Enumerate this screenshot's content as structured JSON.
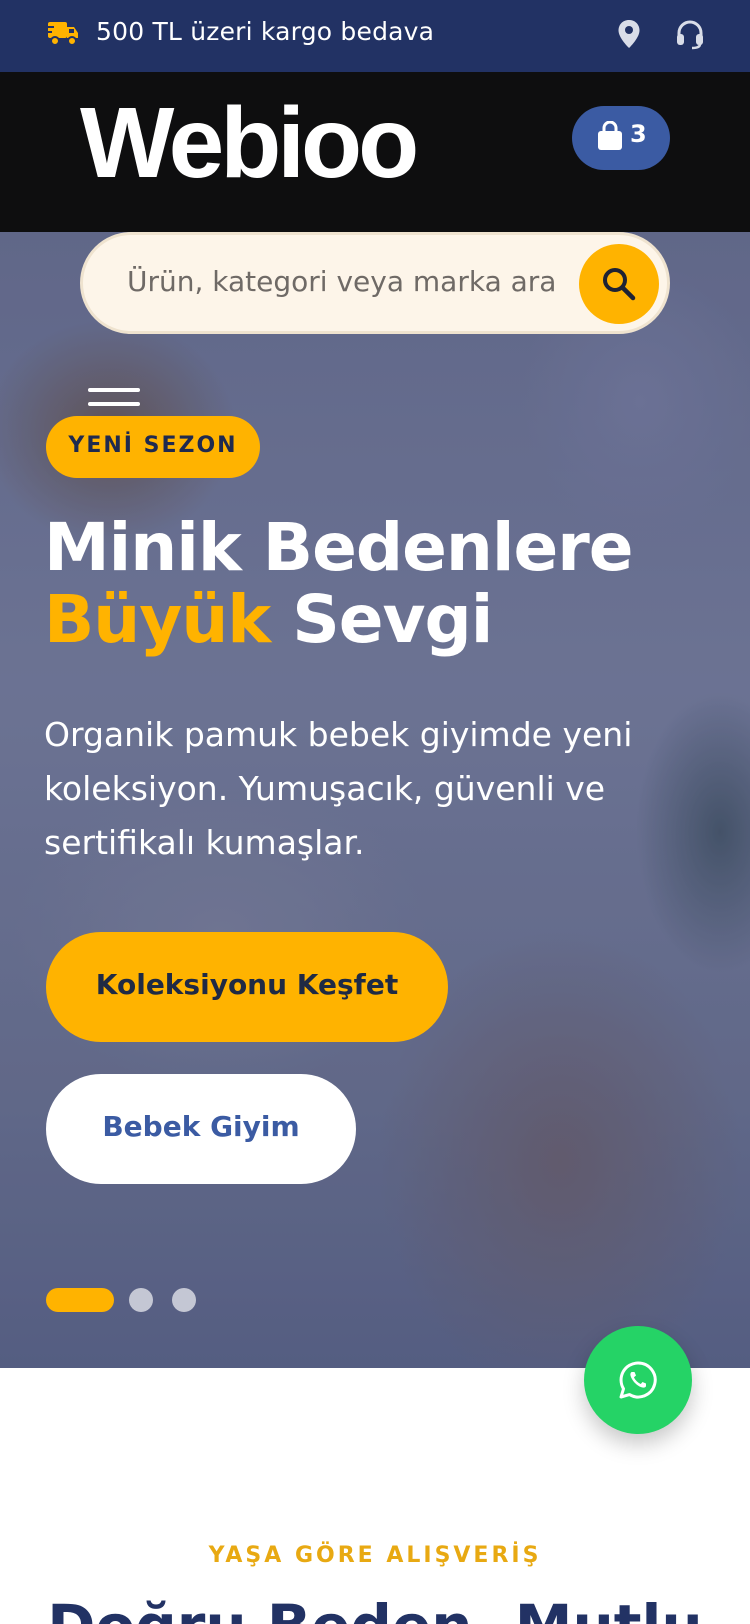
{
  "topbar": {
    "promo_text": "500 TL üzeri kargo bedava",
    "icons": [
      "truck-icon",
      "location-pin-icon",
      "headset-icon"
    ]
  },
  "header": {
    "logo_text": "Webioo",
    "cart_count": "3"
  },
  "search": {
    "placeholder": "Ürün, kategori veya marka ara"
  },
  "hero": {
    "badge": "YENİ SEZON",
    "title_line1": "Minik Bedenlere",
    "title_accent": "Büyük",
    "title_rest": "Sevgi",
    "description": "Organik pamuk bebek giyimde yeni koleksiyon. Yumuşacık, güvenli ve sertifikalı kumaşlar.",
    "primary_button": "Koleksiyonu Keşfet",
    "secondary_button": "Bebek Giyim",
    "slides_total": 3,
    "slide_active": 1
  },
  "section": {
    "eyebrow": "YAŞA GÖRE ALIŞVERİŞ",
    "title": "Doğru Beden, Mutlu"
  },
  "colors": {
    "navy": "#223264",
    "accent": "#ffb300",
    "blue": "#3b5ba3",
    "whatsapp": "#25d366"
  }
}
